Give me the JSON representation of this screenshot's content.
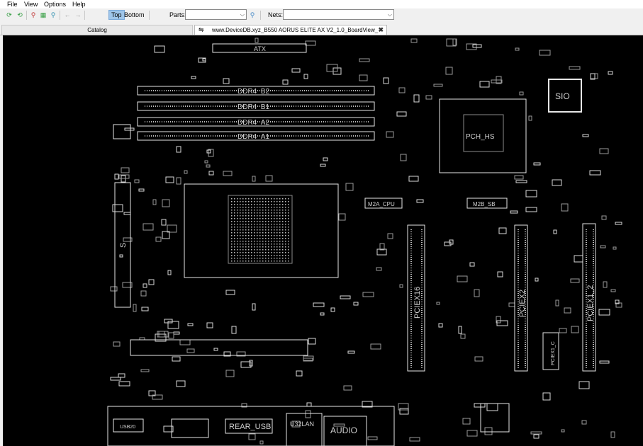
{
  "menu": [
    "File",
    "View",
    "Options",
    "Help"
  ],
  "toolbar": {
    "icons": [
      "refresh-green-icon",
      "refresh-green-icon",
      "zoom-out-icon",
      "fit-view-icon",
      "zoom-in-icon",
      "back-arrow-icon",
      "forward-arrow-icon"
    ],
    "top_label": "Top",
    "bottom_label": "Bottom",
    "parts_label": "Parts:",
    "parts_value": "",
    "nets_label": "Nets:",
    "nets_value": ""
  },
  "tabs": {
    "catalog": "Catalog",
    "board": "www.DeviceDB.xyz_B550 AORUS ELITE AX V2_1.0_BoardView_"
  },
  "board": {
    "labels": {
      "atx": "ATX",
      "ddr4_b2": "DDR4_B2",
      "ddr4_b1": "DDR4_B1",
      "ddr4_a2": "DDR4_A2",
      "ddr4_a1": "DDR4_A1",
      "sio": "SIO",
      "pch_hs": "PCH_HS",
      "m2a_cpu": "M2A_CPU",
      "m2b_sb": "M2B_SB",
      "pciex16": "PCIEX16",
      "pciex2": "PCIEX2",
      "pciex1_2": "PCIEX1_2",
      "rear_usb": "REAR_USB",
      "usb_lan": "U32LAN",
      "audio": "AUDIO",
      "usb20": "USB20",
      "s_label": "S",
      "ec": "PCIEX1_C"
    },
    "colors": {
      "background": "#000000",
      "outline": "#e6e6e6",
      "dim": "#8a8a8a"
    }
  }
}
